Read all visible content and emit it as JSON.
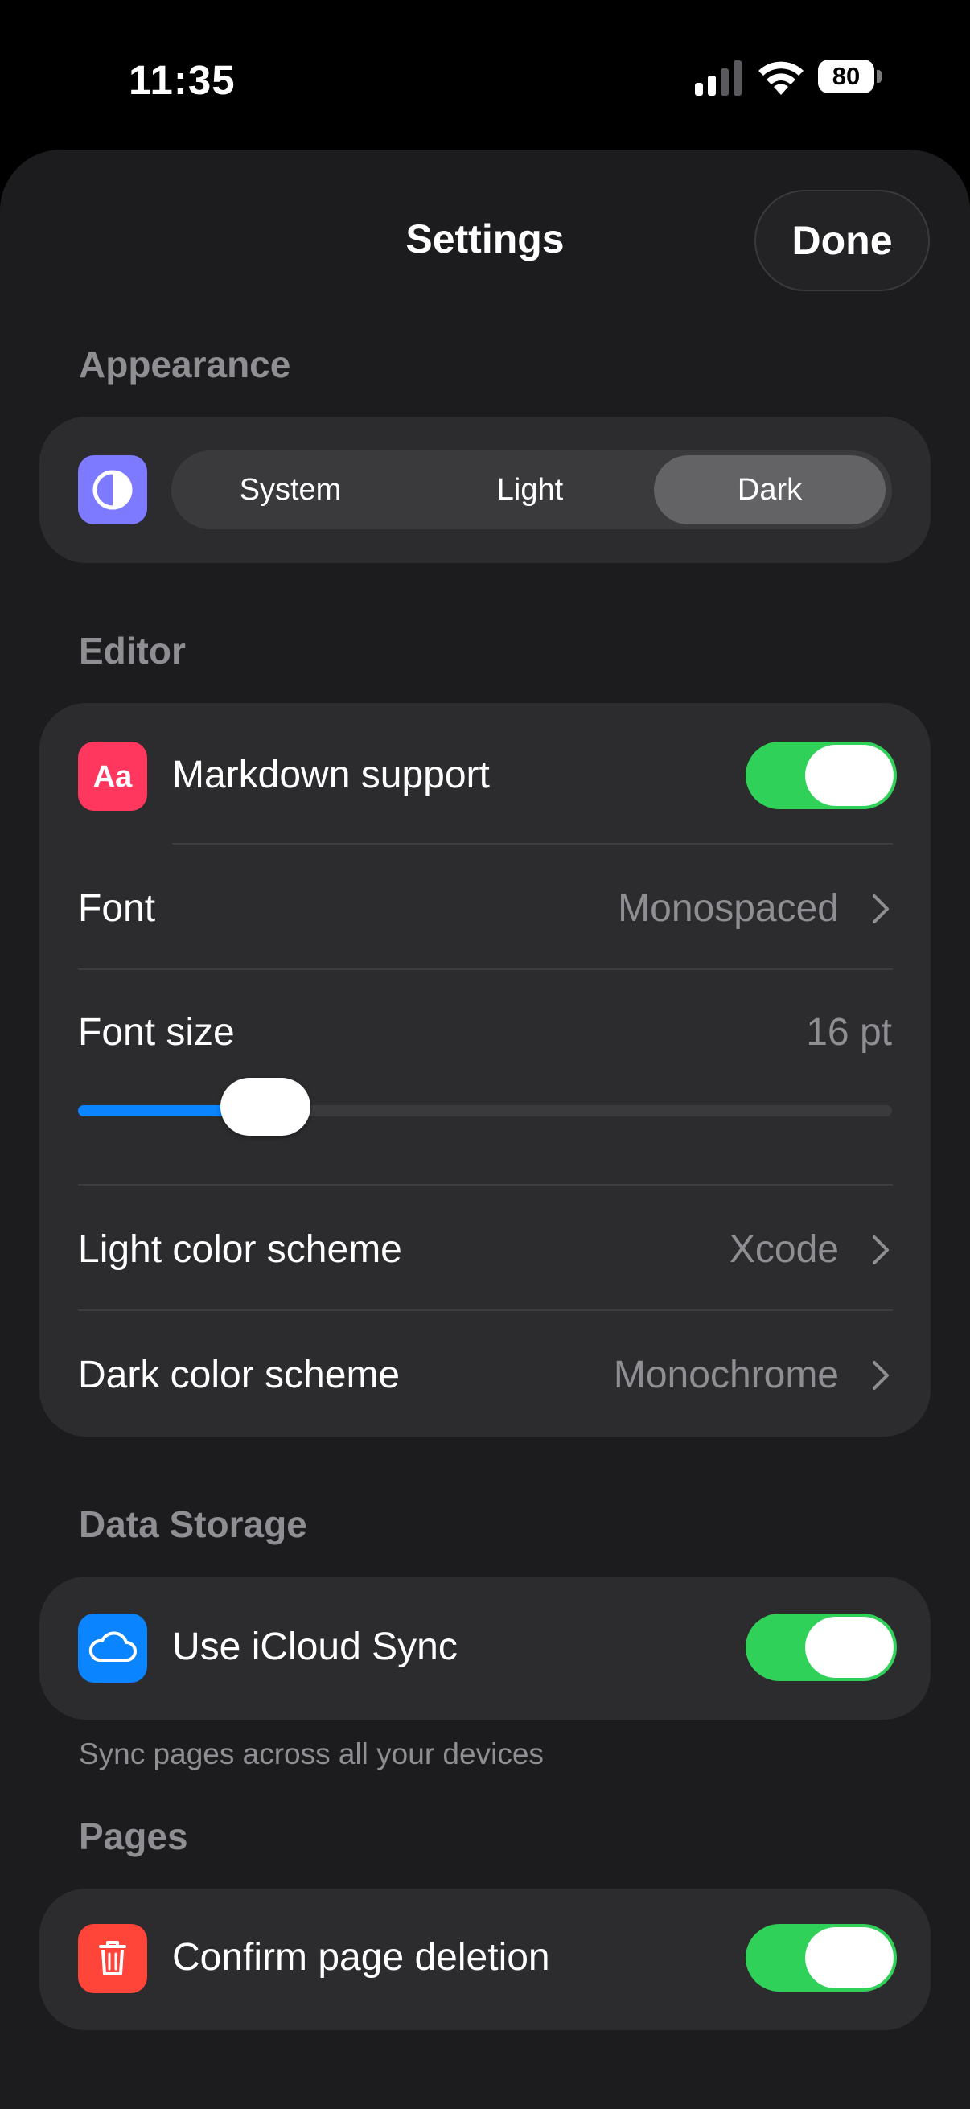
{
  "status_bar": {
    "time": "11:35",
    "battery": "80"
  },
  "header": {
    "title": "Settings",
    "done_label": "Done"
  },
  "appearance": {
    "section_label": "Appearance",
    "options": [
      "System",
      "Light",
      "Dark"
    ],
    "selected": "Dark"
  },
  "editor": {
    "section_label": "Editor",
    "markdown": {
      "label": "Markdown support",
      "enabled": true
    },
    "font": {
      "label": "Font",
      "value": "Monospaced"
    },
    "font_size": {
      "label": "Font size",
      "value_text": "16 pt",
      "slider_fraction": 0.23
    },
    "light_scheme": {
      "label": "Light color scheme",
      "value": "Xcode"
    },
    "dark_scheme": {
      "label": "Dark color scheme",
      "value": "Monochrome"
    }
  },
  "data_storage": {
    "section_label": "Data Storage",
    "icloud": {
      "label": "Use iCloud Sync",
      "enabled": true
    },
    "footnote": "Sync pages across all your devices"
  },
  "pages": {
    "section_label": "Pages",
    "confirm_delete": {
      "label": "Confirm page deletion",
      "enabled": true
    }
  },
  "colors": {
    "accent_blue": "#0a84ff",
    "toggle_on": "#30d158",
    "appearance_icon": "#7d7aff",
    "markdown_icon": "#ff375f",
    "icloud_icon": "#0a84ff",
    "trash_icon": "#ff453a"
  },
  "icons": [
    "appearance-contrast-icon",
    "markdown-aa-icon",
    "cloud-icon",
    "trash-icon",
    "chevron-right-icon"
  ]
}
